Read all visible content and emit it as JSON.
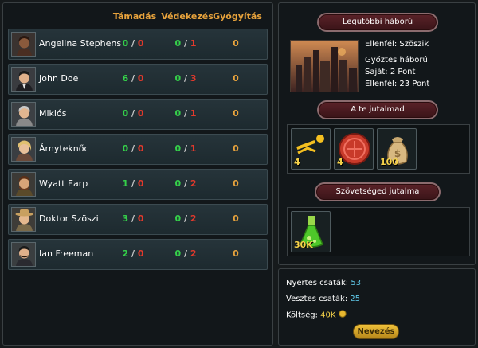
{
  "table": {
    "headers": {
      "attack": "Támadás",
      "defense": "Védekezés",
      "healing": "Gyógyítás"
    },
    "players": [
      {
        "name": "Angelina Stephens",
        "attack": [
          "0",
          "0"
        ],
        "defense": [
          "0",
          "1"
        ],
        "healing": "0"
      },
      {
        "name": "John Doe",
        "attack": [
          "6",
          "0"
        ],
        "defense": [
          "0",
          "3"
        ],
        "healing": "0"
      },
      {
        "name": "Miklós",
        "attack": [
          "0",
          "0"
        ],
        "defense": [
          "0",
          "1"
        ],
        "healing": "0"
      },
      {
        "name": "Árnyteknőc",
        "attack": [
          "0",
          "0"
        ],
        "defense": [
          "0",
          "1"
        ],
        "healing": "0"
      },
      {
        "name": "Wyatt Earp",
        "attack": [
          "1",
          "0"
        ],
        "defense": [
          "0",
          "2"
        ],
        "healing": "0"
      },
      {
        "name": "Doktor Szöszi",
        "attack": [
          "3",
          "0"
        ],
        "defense": [
          "0",
          "2"
        ],
        "healing": "0"
      },
      {
        "name": "Ian Freeman",
        "attack": [
          "2",
          "0"
        ],
        "defense": [
          "0",
          "2"
        ],
        "healing": "0"
      }
    ]
  },
  "last_war": {
    "title": "Legutóbbi háború",
    "enemy": "Ellenfél: Szöszik",
    "winner": "Győztes háború",
    "own": "Saját: 2 Pont",
    "opponent": "Ellenfél: 23 Pont"
  },
  "your_reward": {
    "title": "A te jutalmad",
    "items": [
      {
        "icon": "running-figure-icon",
        "count": "4"
      },
      {
        "icon": "red-token-icon",
        "count": "4"
      },
      {
        "icon": "money-bag-icon",
        "count": "100"
      }
    ]
  },
  "alliance_reward": {
    "title": "Szövetséged jutalma",
    "items": [
      {
        "icon": "green-potion-icon",
        "count": "30K"
      }
    ]
  },
  "summary": {
    "wins_label": "Nyertes csaták:",
    "wins": "53",
    "losses_label": "Vesztes csaták:",
    "losses": "25",
    "cost_label": "Költség:",
    "cost": "40K",
    "register_button": "Nevezés"
  },
  "colors": {
    "accent": "#e8a33c",
    "win": "#35d14a",
    "loss": "#e2392c",
    "cyan": "#5fc8e8"
  }
}
